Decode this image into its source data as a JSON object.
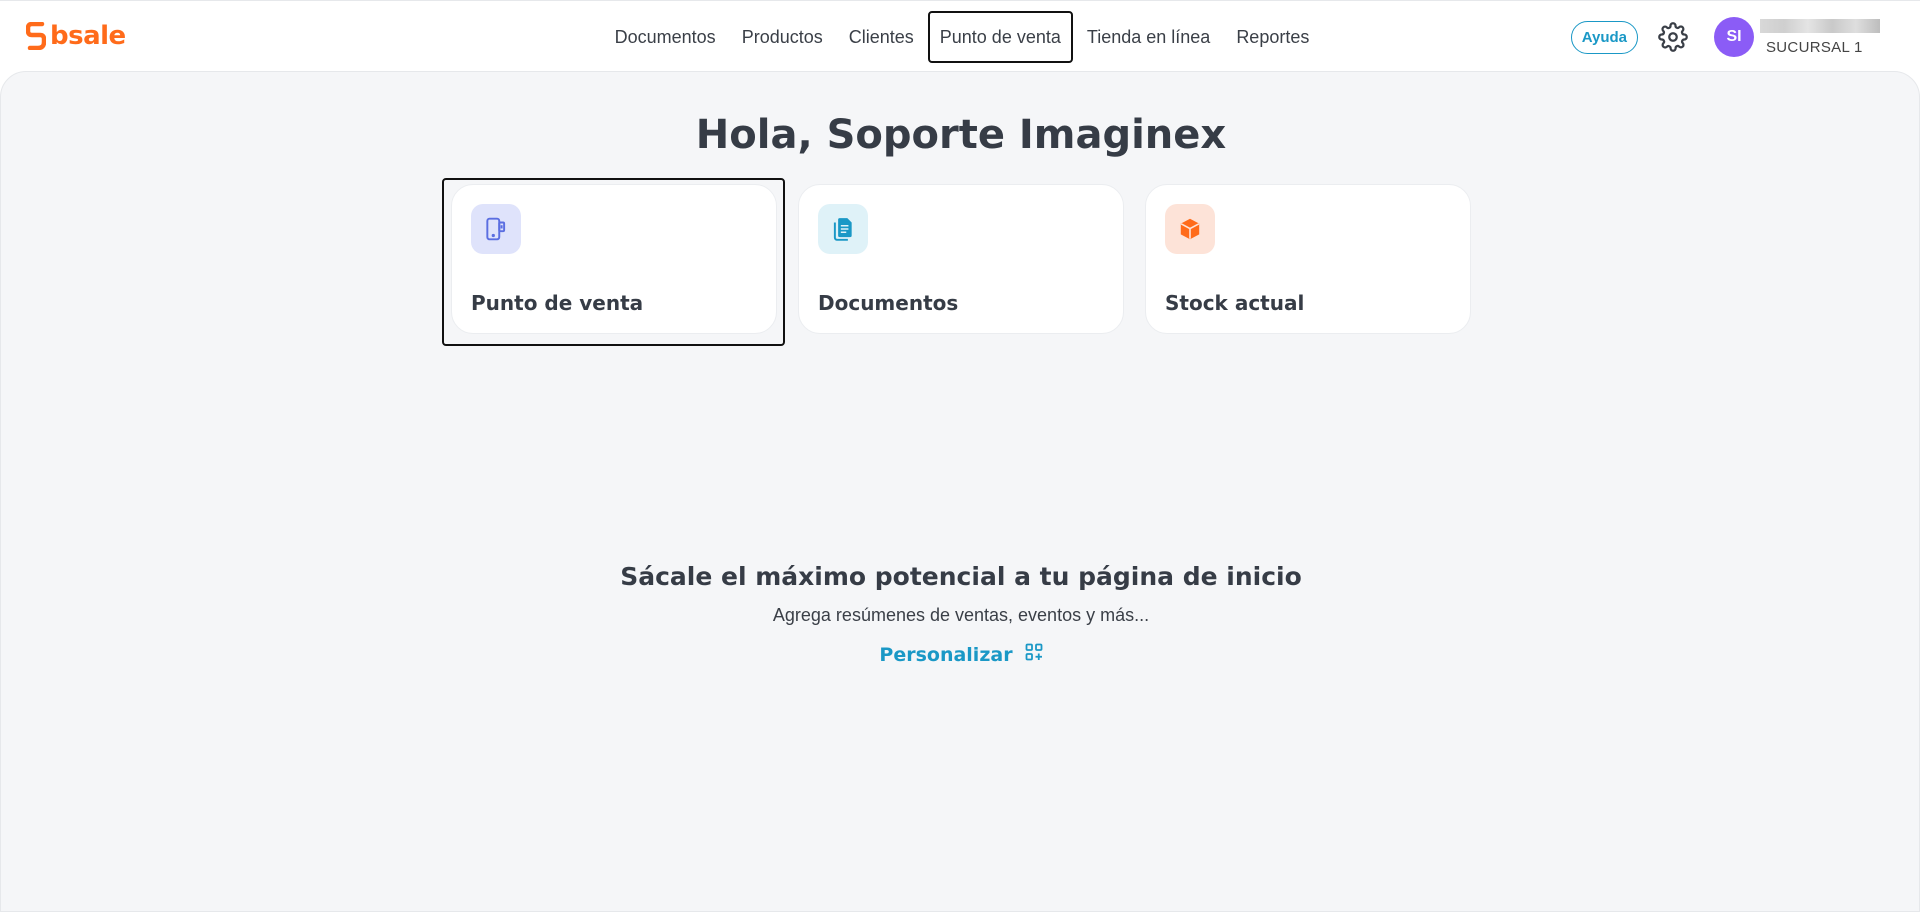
{
  "logo": {
    "text": "bsale",
    "color": "#ff6b1a"
  },
  "nav": {
    "items": [
      {
        "label": "Documentos"
      },
      {
        "label": "Productos"
      },
      {
        "label": "Clientes"
      },
      {
        "label": "Punto de venta",
        "active": true
      },
      {
        "label": "Tienda en línea"
      },
      {
        "label": "Reportes"
      }
    ]
  },
  "header": {
    "help_label": "Ayuda",
    "avatar_initials": "SI",
    "branch": "SUCURSAL 1"
  },
  "main": {
    "greeting": "Hola, Soporte Imaginex",
    "cards": [
      {
        "label": "Punto de venta",
        "icon": "pos-device-icon",
        "icon_bg": "#dfe3fb",
        "icon_color": "#5b6ee1"
      },
      {
        "label": "Documentos",
        "icon": "documents-icon",
        "icon_bg": "#dff2f8",
        "icon_color": "#1a98c6"
      },
      {
        "label": "Stock actual",
        "icon": "box-icon",
        "icon_bg": "#fde3d8",
        "icon_color": "#ff6b1a"
      }
    ],
    "promo_title": "Sácale el máximo potencial a tu página de inicio",
    "promo_subtitle": "Agrega resúmenes de ventas, eventos y más...",
    "personalize_label": "Personalizar"
  },
  "colors": {
    "accent": "#1a98c6",
    "brand": "#ff6b1a",
    "avatar": "#8b5cf6"
  }
}
